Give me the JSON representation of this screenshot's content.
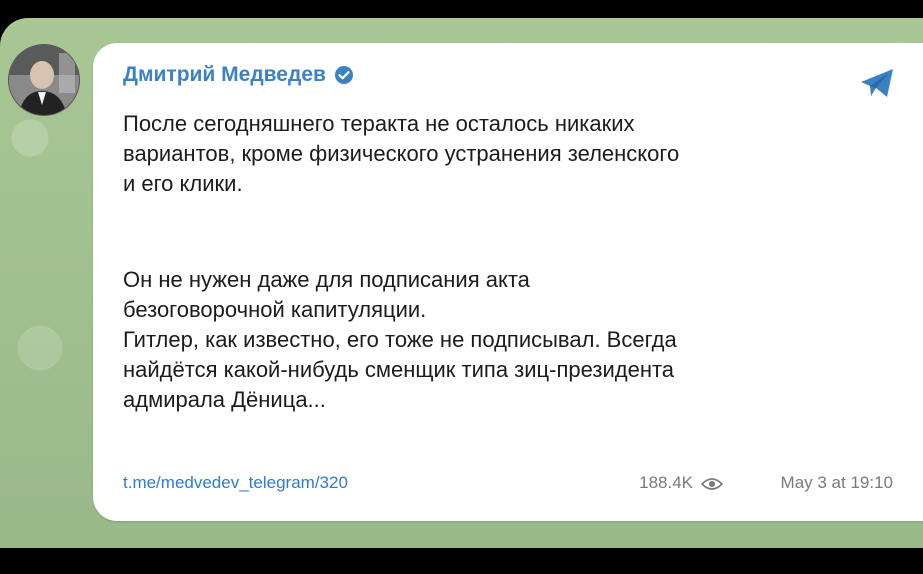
{
  "post": {
    "author": "Дмитрий Медведев",
    "paragraph1": [
      "После сегодняшнего теракта не осталось никаких",
      "вариантов, кроме физического устранения зеленского",
      "и его клики."
    ],
    "paragraph2": [
      "Он не нужен даже для подписания акта",
      "безоговорочной капитуляции.",
      "Гитлер, как известно, его тоже не подписывал. Всегда",
      "найдётся какой-нибудь сменщик типа зиц-президента",
      "адмирала Дёница..."
    ],
    "link": "t.me/medvedev_telegram/320",
    "views": "188.4K",
    "date": "May 3 at 19:10"
  },
  "colors": {
    "accent": "#3b82c4",
    "chat_background": "#9dbd8e"
  },
  "icons": {
    "verified": "verified-badge-icon",
    "share": "telegram-share-icon",
    "views": "eye-icon"
  }
}
